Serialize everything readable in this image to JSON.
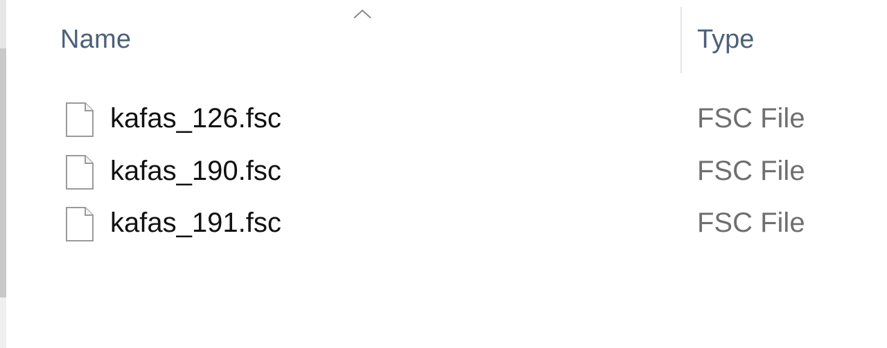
{
  "columns": {
    "name_label": "Name",
    "type_label": "Type",
    "sort_icon": "chevron-up-icon"
  },
  "files": [
    {
      "name": "kafas_126.fsc",
      "type": "FSC File",
      "icon": "document-icon"
    },
    {
      "name": "kafas_190.fsc",
      "type": "FSC File",
      "icon": "document-icon"
    },
    {
      "name": "kafas_191.fsc",
      "type": "FSC File",
      "icon": "document-icon"
    }
  ],
  "colors": {
    "header_text": "#4c607a",
    "file_name_text": "#111111",
    "file_type_text": "#6f6f6f"
  }
}
